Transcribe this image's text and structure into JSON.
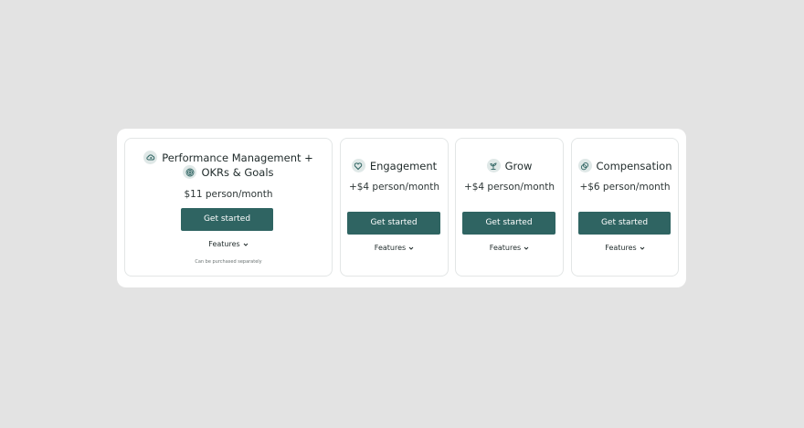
{
  "cards": [
    {
      "title_line1": "Performance Management +",
      "title_line2": "OKRs & Goals",
      "icon1": "cloud-arrows-icon",
      "icon2": "target-icon",
      "price": "$11 person/month",
      "button": "Get started",
      "features": "Features",
      "note": "Can be purchased separately"
    },
    {
      "title": "Engagement",
      "icon": "heart-icon",
      "price": "+$4 person/month",
      "button": "Get started",
      "features": "Features"
    },
    {
      "title": "Grow",
      "icon": "plant-icon",
      "price": "+$4 person/month",
      "button": "Get started",
      "features": "Features"
    },
    {
      "title": "Compensation",
      "icon": "coins-icon",
      "price": "+$6 person/month",
      "button": "Get started",
      "features": "Features"
    }
  ],
  "colors": {
    "background": "#e3e3e3",
    "panel": "#ffffff",
    "button": "#2f6462",
    "icon_bg": "#dfe8e7",
    "text": "#1f2a2a"
  }
}
